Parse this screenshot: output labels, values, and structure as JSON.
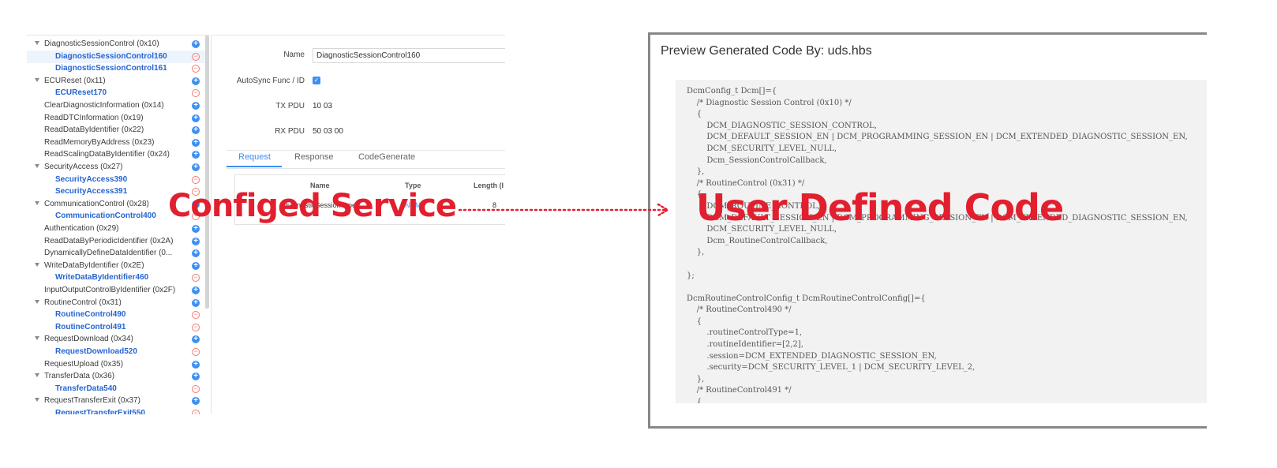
{
  "tree": {
    "items": [
      {
        "label": "DiagnosticSessionControl (0x10)",
        "level": 0,
        "expanded": true,
        "action": "add"
      },
      {
        "label": "DiagnosticSessionControl160",
        "level": 1,
        "selected": true,
        "action": "remove"
      },
      {
        "label": "DiagnosticSessionControl161",
        "level": 1,
        "action": "remove"
      },
      {
        "label": "ECUReset (0x11)",
        "level": 0,
        "expanded": true,
        "action": "add"
      },
      {
        "label": "ECUReset170",
        "level": 1,
        "action": "remove"
      },
      {
        "label": "ClearDiagnosticInformation (0x14)",
        "level": 0,
        "action": "add"
      },
      {
        "label": "ReadDTCInformation (0x19)",
        "level": 0,
        "action": "add"
      },
      {
        "label": "ReadDataByIdentifier (0x22)",
        "level": 0,
        "action": "add"
      },
      {
        "label": "ReadMemoryByAddress (0x23)",
        "level": 0,
        "action": "add"
      },
      {
        "label": "ReadScalingDataByIdentifier (0x24)",
        "level": 0,
        "action": "add"
      },
      {
        "label": "SecurityAccess (0x27)",
        "level": 0,
        "expanded": true,
        "action": "add"
      },
      {
        "label": "SecurityAccess390",
        "level": 1,
        "action": "remove"
      },
      {
        "label": "SecurityAccess391",
        "level": 1,
        "action": "remove"
      },
      {
        "label": "CommunicationControl (0x28)",
        "level": 0,
        "expanded": true,
        "action": "add"
      },
      {
        "label": "CommunicationControl400",
        "level": 1,
        "action": "remove"
      },
      {
        "label": "Authentication (0x29)",
        "level": 0,
        "action": "add"
      },
      {
        "label": "ReadDataByPeriodicIdentifier (0x2A)",
        "level": 0,
        "action": "add"
      },
      {
        "label": "DynamicallyDefineDataIdentifier (0...",
        "level": 0,
        "action": "add"
      },
      {
        "label": "WriteDataByIdentifier (0x2E)",
        "level": 0,
        "expanded": true,
        "action": "add"
      },
      {
        "label": "WriteDataByIdentifier460",
        "level": 1,
        "action": "remove"
      },
      {
        "label": "InputOutputControlByIdentifier (0x2F)",
        "level": 0,
        "action": "add"
      },
      {
        "label": "RoutineControl (0x31)",
        "level": 0,
        "expanded": true,
        "action": "add"
      },
      {
        "label": "RoutineControl490",
        "level": 1,
        "action": "remove"
      },
      {
        "label": "RoutineControl491",
        "level": 1,
        "action": "remove"
      },
      {
        "label": "RequestDownload (0x34)",
        "level": 0,
        "expanded": true,
        "action": "add"
      },
      {
        "label": "RequestDownload520",
        "level": 1,
        "action": "remove"
      },
      {
        "label": "RequestUpload (0x35)",
        "level": 0,
        "action": "add"
      },
      {
        "label": "TransferData (0x36)",
        "level": 0,
        "expanded": true,
        "action": "add"
      },
      {
        "label": "TransferData540",
        "level": 1,
        "action": "remove"
      },
      {
        "label": "RequestTransferExit (0x37)",
        "level": 0,
        "expanded": true,
        "action": "add"
      },
      {
        "label": "RequestTransferExit550",
        "level": 1,
        "action": "remove"
      }
    ]
  },
  "form": {
    "name_label": "Name",
    "name_value": "DiagnosticSessionControl160",
    "autosync_label": "AutoSync Func / ID",
    "autosync_checked": true,
    "tx_label": "TX PDU",
    "tx_value": "10 03",
    "rx_label": "RX PDU",
    "rx_value": "50 03 00",
    "tabs": [
      "Request",
      "Response",
      "CodeGenerate"
    ],
    "active_tab": "Request",
    "grid_headers": [
      "Name",
      "Type",
      "Length (I"
    ],
    "grid_row": {
      "name": "diagnosticSessionType",
      "type": "NUM",
      "length": "8"
    }
  },
  "preview": {
    "title": "Preview Generated Code By: uds.hbs",
    "code": "DcmConfig_t Dcm[]={\n    /* Diagnostic Session Control (0x10) */\n    {\n        DCM_DIAGNOSTIC_SESSION_CONTROL,\n        DCM_DEFAULT_SESSION_EN | DCM_PROGRAMMING_SESSION_EN | DCM_EXTENDED_DIAGNOSTIC_SESSION_EN,\n        DCM_SECURITY_LEVEL_NULL,\n        Dcm_SessionControlCallback,\n    },\n    /* RoutineControl (0x31) */\n    {\n        DCM_ROUTINE_CONTROL,\n        DCM_DEFAULT_SESSION_EN | DCM_PROGRAMMING_SESSION_EN | DCM_EXTENDED_DIAGNOSTIC_SESSION_EN,\n        DCM_SECURITY_LEVEL_NULL,\n        Dcm_RoutineControlCallback,\n    },\n\n};\n\nDcmRoutineControlConfig_t DcmRoutineControlConfig[]={\n    /* RoutineControl490 */\n    {\n        .routineControlType=1,\n        .routineIdentifier=[2,2],\n        .session=DCM_EXTENDED_DIAGNOSTIC_SESSION_EN,\n        .security=DCM_SECURITY_LEVEL_1 | DCM_SECURITY_LEVEL_2,\n    },\n    /* RoutineControl491 */\n    {"
  },
  "annotations": {
    "left": "Configed Service",
    "right": "User Defined Code",
    "arrow_color": "#e21f2e"
  },
  "colors": {
    "accent": "#3d8ff2",
    "child_text": "#2565d0",
    "remove": "#f07a72",
    "annotation": "#e21f2e"
  }
}
